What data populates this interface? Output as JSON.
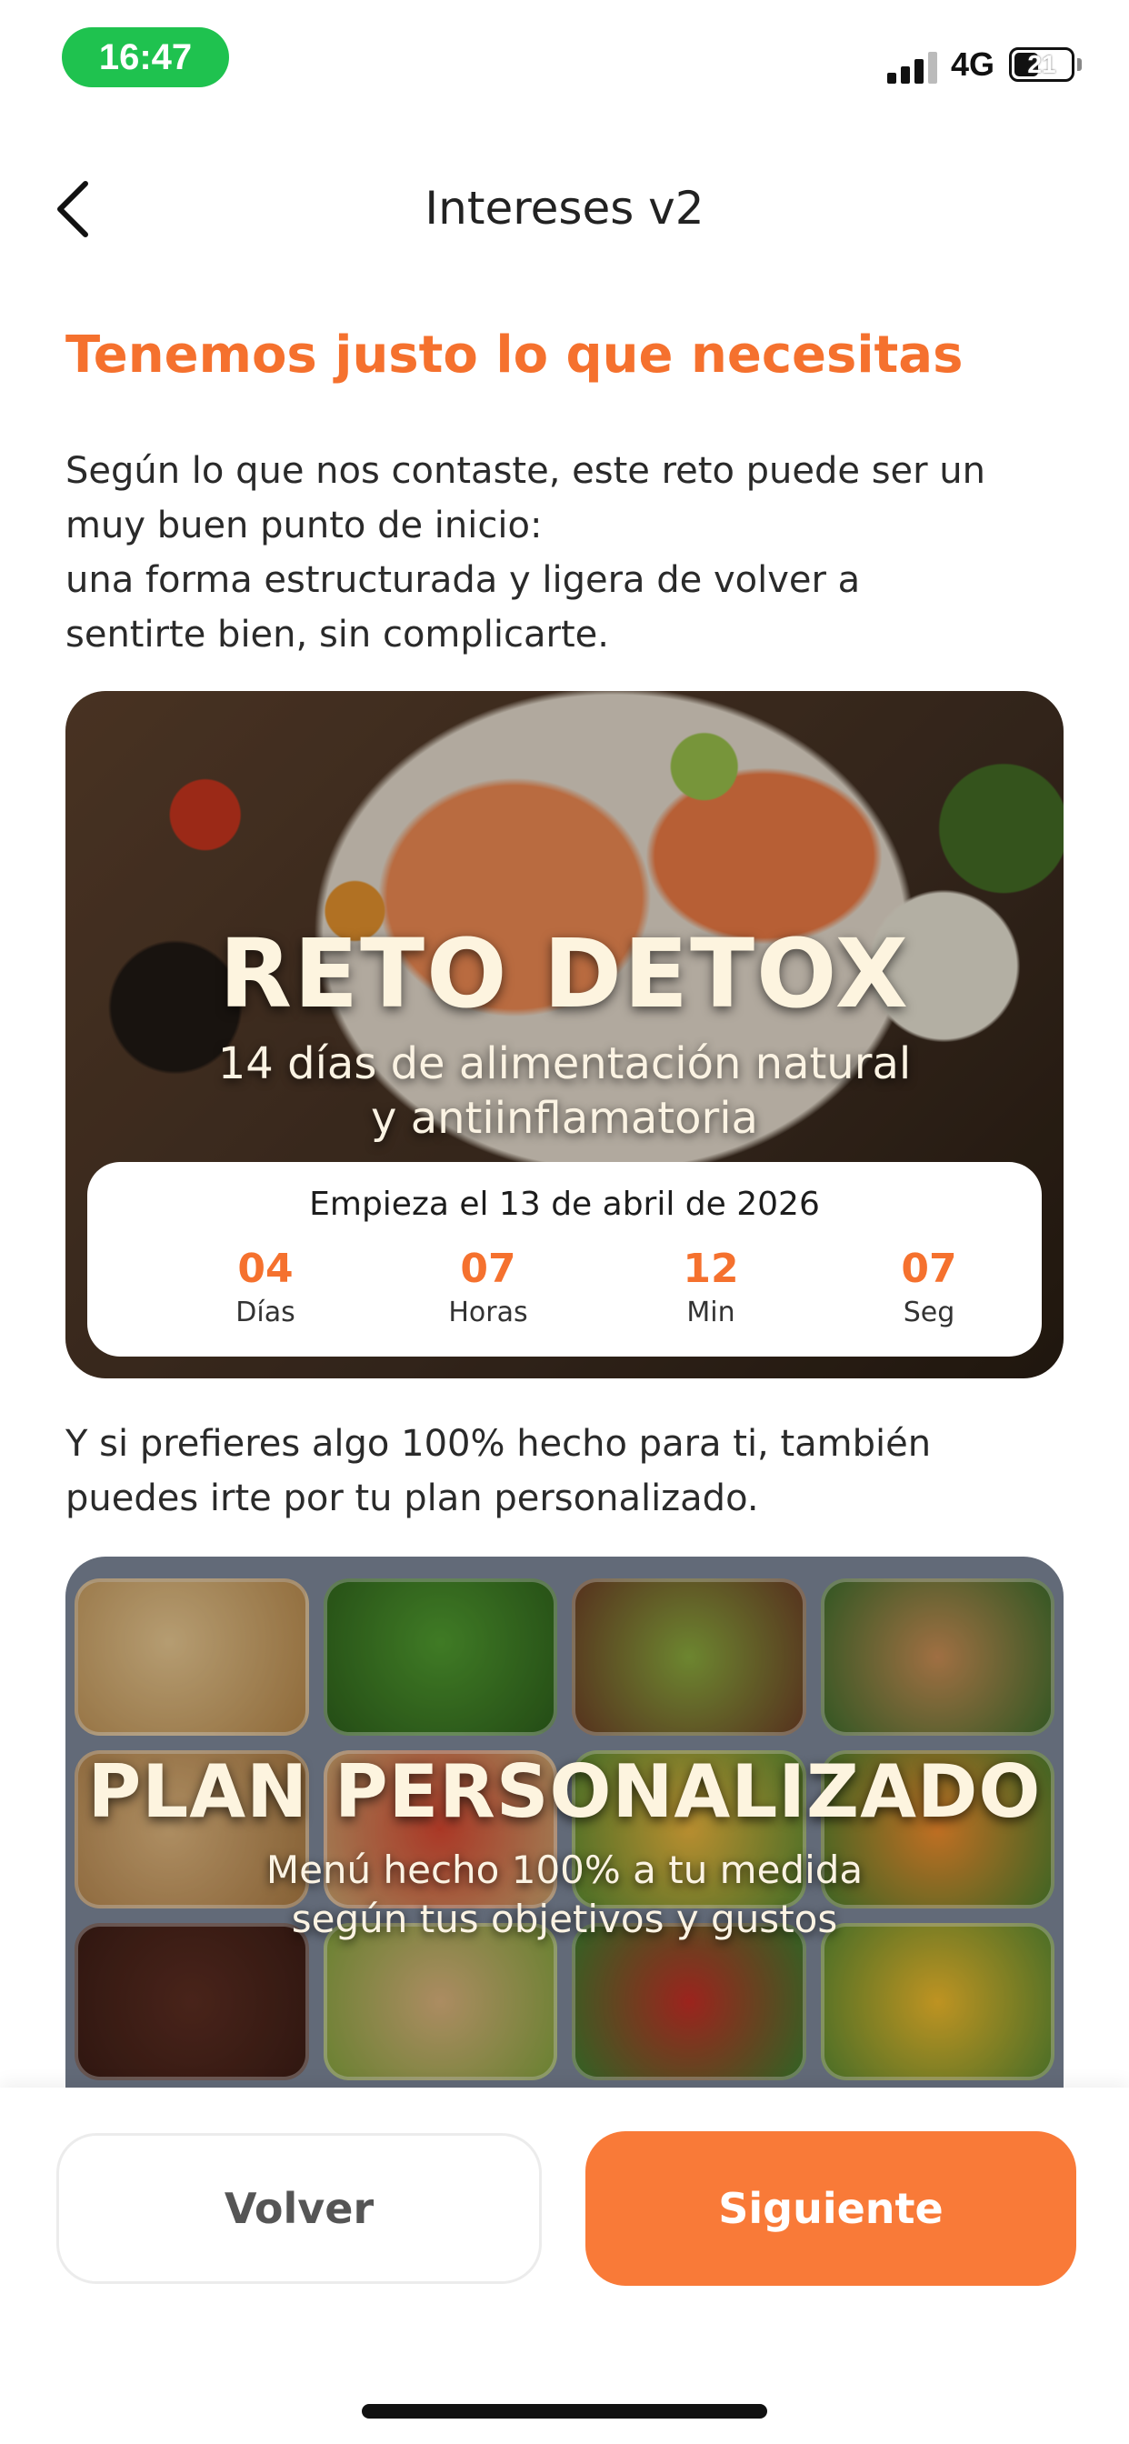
{
  "status_bar": {
    "time": "16:47",
    "network": "4G",
    "battery": "21"
  },
  "nav": {
    "title": "Intereses v2"
  },
  "content": {
    "headline": "Tenemos justo lo que necesitas",
    "intro_lines": [
      "Según lo que nos contaste, este reto puede ser un",
      "muy buen punto de inicio:",
      "una forma estructurada y ligera de volver a",
      "sentirte bien, sin complicarte."
    ],
    "detox_card": {
      "title": "RETO DETOX",
      "subtitle_line1": "14 días de alimentación natural",
      "subtitle_line2": "y antiinflamatoria",
      "countdown": {
        "heading": "Empieza el 13 de abril de 2026",
        "units": [
          {
            "value": "04",
            "label": "Días"
          },
          {
            "value": "07",
            "label": "Horas"
          },
          {
            "value": "12",
            "label": "Min"
          },
          {
            "value": "07",
            "label": "Seg"
          }
        ]
      }
    },
    "secondary_lines": [
      "Y si prefieres algo 100% hecho para ti, también",
      "puedes irte por tu plan personalizado."
    ],
    "plan_card": {
      "title": "PLAN PERSONALIZADO",
      "subtitle_line1": "Menú hecho 100% a tu medida",
      "subtitle_line2": "según tus objetivos y gustos"
    }
  },
  "footer": {
    "back_label": "Volver",
    "next_label": "Siguiente"
  },
  "colors": {
    "accent": "#f5712e",
    "button_primary": "#f97a38",
    "status_time_pill": "#1fc24f"
  },
  "icons": {
    "back": "chevron-left-icon"
  }
}
